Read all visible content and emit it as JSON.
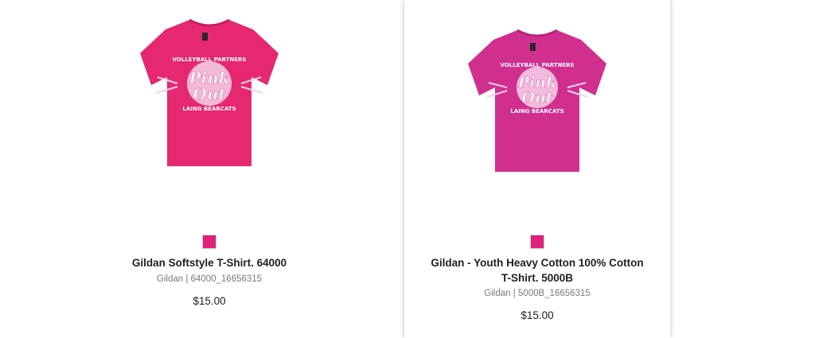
{
  "products": [
    {
      "title": "Gildan Softstyle T-Shirt. 64000",
      "sku": "Gildan | 64000_16656315",
      "price": "$15.00",
      "swatch_color": "#e0207a",
      "shirt_color": "#e5286f",
      "graphic_text_top": "VOLLEYBALL PARTNERS",
      "graphic_text_main_1": "Pink",
      "graphic_text_main_2": "Out",
      "graphic_text_bottom": "LAING BEARCATS"
    },
    {
      "title": "Gildan - Youth Heavy Cotton 100% Cotton T-Shirt. 5000B",
      "sku": "Gildan | 5000B_16656315",
      "price": "$15.00",
      "swatch_color": "#e0207a",
      "shirt_color": "#d12f8d",
      "graphic_text_top": "VOLLEYBALL PARTNERS",
      "graphic_text_main_1": "Pink",
      "graphic_text_main_2": "Out",
      "graphic_text_bottom": "LAING BEARCATS"
    }
  ]
}
